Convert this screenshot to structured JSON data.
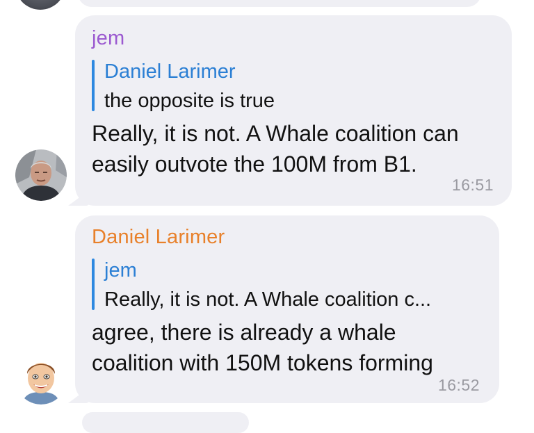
{
  "messages": [
    {
      "sender": "jem",
      "sender_color": "#9b59d0",
      "reply_to_name": "Daniel Larimer",
      "reply_to_text": "the opposite is true",
      "lines": [
        "Really, it is not. A Whale coalition can",
        "easily outvote the 100M from B1."
      ],
      "time": "16:51",
      "avatar_icon": "avatar-photo-man-icon"
    },
    {
      "sender": "Daniel Larimer",
      "sender_color": "#e8802a",
      "reply_to_name": "jem",
      "reply_to_text": "Really, it is not. A Whale coalition c...",
      "lines": [
        "agree, there is already a whale",
        "coalition with 150M tokens forming"
      ],
      "time": "16:52",
      "avatar_icon": "avatar-cartoon-man-icon"
    }
  ],
  "colors": {
    "bubble_bg": "#efeff4",
    "reply_bar": "#2d88e0",
    "reply_name": "#2b7fd4",
    "time": "#9a9aa1"
  }
}
